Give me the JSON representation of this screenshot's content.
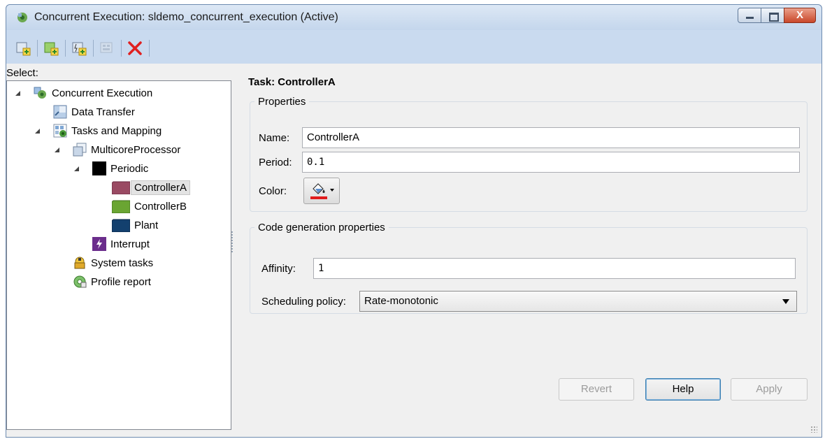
{
  "window": {
    "title": "Concurrent Execution: sldemo_concurrent_execution (Active)",
    "controls": {
      "minimize": "minimize",
      "maximize": "maximize",
      "close": "X"
    }
  },
  "toolbar": {
    "icons": [
      "add-task-icon",
      "add-periodic-trigger-icon",
      "add-interrupt-icon",
      "add-grouped-icon-disabled",
      "delete-icon"
    ]
  },
  "tree": {
    "select_label": "Select:",
    "items": [
      {
        "label": "Concurrent Execution",
        "icon": "concurrent-execution-icon",
        "expanded": true
      },
      {
        "label": "Data Transfer",
        "icon": "data-transfer-icon"
      },
      {
        "label": "Tasks and Mapping",
        "icon": "tasks-mapping-icon",
        "expanded": true
      },
      {
        "label": "MulticoreProcessor",
        "icon": "processor-icon",
        "expanded": true
      },
      {
        "label": "Periodic",
        "icon": "periodic-color-icon",
        "color": "#000000",
        "expanded": true
      },
      {
        "label": "ControllerA",
        "icon": "task-color-icon",
        "color": "#9a4a63",
        "selected": true
      },
      {
        "label": "ControllerB",
        "icon": "task-color-icon",
        "color": "#6aa532"
      },
      {
        "label": "Plant",
        "icon": "task-color-icon",
        "color": "#13406e"
      },
      {
        "label": "Interrupt",
        "icon": "interrupt-icon",
        "color": "#6b2d8c"
      },
      {
        "label": "System tasks",
        "icon": "system-tasks-icon"
      },
      {
        "label": "Profile report",
        "icon": "profile-report-icon"
      }
    ]
  },
  "task": {
    "title": "Task: ControllerA",
    "properties": {
      "legend": "Properties",
      "name_label": "Name:",
      "name_value": "ControllerA",
      "period_label": "Period:",
      "period_value": "0.1",
      "color_label": "Color:",
      "color_value": "#e01b1b"
    },
    "codegen": {
      "legend": "Code generation properties",
      "affinity_label": "Affinity:",
      "affinity_value": "1",
      "policy_label": "Scheduling policy:",
      "policy_value": "Rate-monotonic"
    }
  },
  "buttons": {
    "revert": "Revert",
    "help": "Help",
    "apply": "Apply"
  }
}
